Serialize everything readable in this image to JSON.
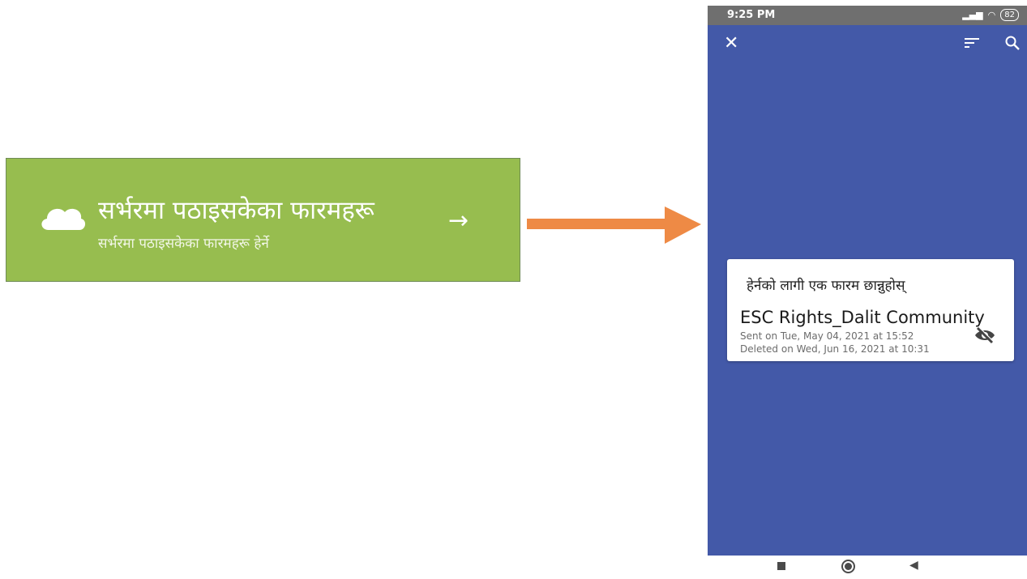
{
  "green_card": {
    "title": "सर्भरमा पठाइसकेका फारमहरू",
    "subtitle": "सर्भरमा पठाइसकेका फारमहरू हेर्ने",
    "arrow": "→",
    "icon": "cloud-icon",
    "color": "#97bd4f"
  },
  "connector": {
    "color": "#ee8a45",
    "icon": "right-arrow"
  },
  "phone": {
    "status_bar": {
      "time": "9:25 PM",
      "battery": "82"
    },
    "app_bar": {
      "close": "✕",
      "color": "#4359a8"
    },
    "dialog": {
      "title": "हेर्नको लागी एक फारम छान्नुहोस्",
      "form_name": "ESC Rights_Dalit Community",
      "sent": "Sent on Tue, May 04, 2021 at 15:52",
      "deleted": "Deleted on Wed, Jun 16, 2021 at 10:31",
      "icon": "visibility-off-icon"
    },
    "nav_bar": {
      "back": "◀"
    }
  }
}
